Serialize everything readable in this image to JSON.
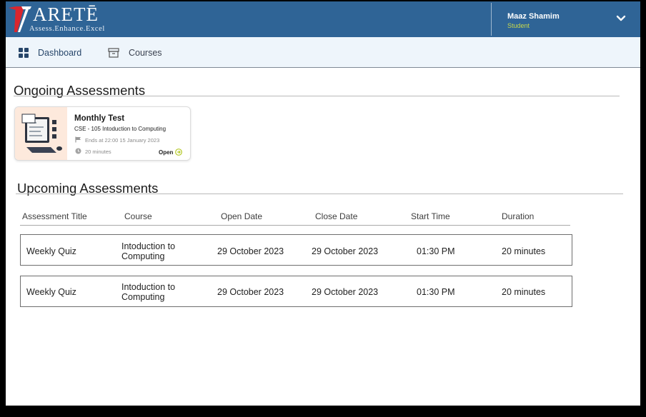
{
  "brand": {
    "name": "ARETĒ",
    "tagline": "Assess.Enhance.Excel",
    "header_color": "#2f6496"
  },
  "user": {
    "name": "Maaz Shamim",
    "role": "Student",
    "menu_icon": "chevron-down-icon"
  },
  "nav": {
    "items": [
      {
        "label": "Dashboard",
        "icon": "dashboard-grid-icon"
      },
      {
        "label": "Courses",
        "icon": "archive-box-icon"
      }
    ]
  },
  "ongoing": {
    "title": "Ongoing Assessments",
    "cards": [
      {
        "title": "Monthly Test",
        "course": "CSE - 105 Intoduction to Computing",
        "ends": "Ends at 22:00 15 January 2023",
        "duration": "20 minutes",
        "action": "Open",
        "image_bg": "#fde9dc"
      }
    ]
  },
  "upcoming": {
    "title": "Upcoming Assessments",
    "columns": [
      "Assessment Title",
      "Course",
      "Open Date",
      "Close Date",
      "Start Time",
      "Duration"
    ],
    "rows": [
      {
        "title": "Weekly Quiz",
        "course_line1": "Intoduction to",
        "course_line2": "Computing",
        "open_date": "29 October 2023",
        "close_date": "29 October 2023",
        "start_time": "01:30 PM",
        "duration": "20 minutes"
      },
      {
        "title": "Weekly Quiz",
        "course_line1": "Intoduction to",
        "course_line2": "Computing",
        "open_date": "29 October 2023",
        "close_date": "29 October 2023",
        "start_time": "01:30 PM",
        "duration": "20 minutes"
      }
    ]
  }
}
